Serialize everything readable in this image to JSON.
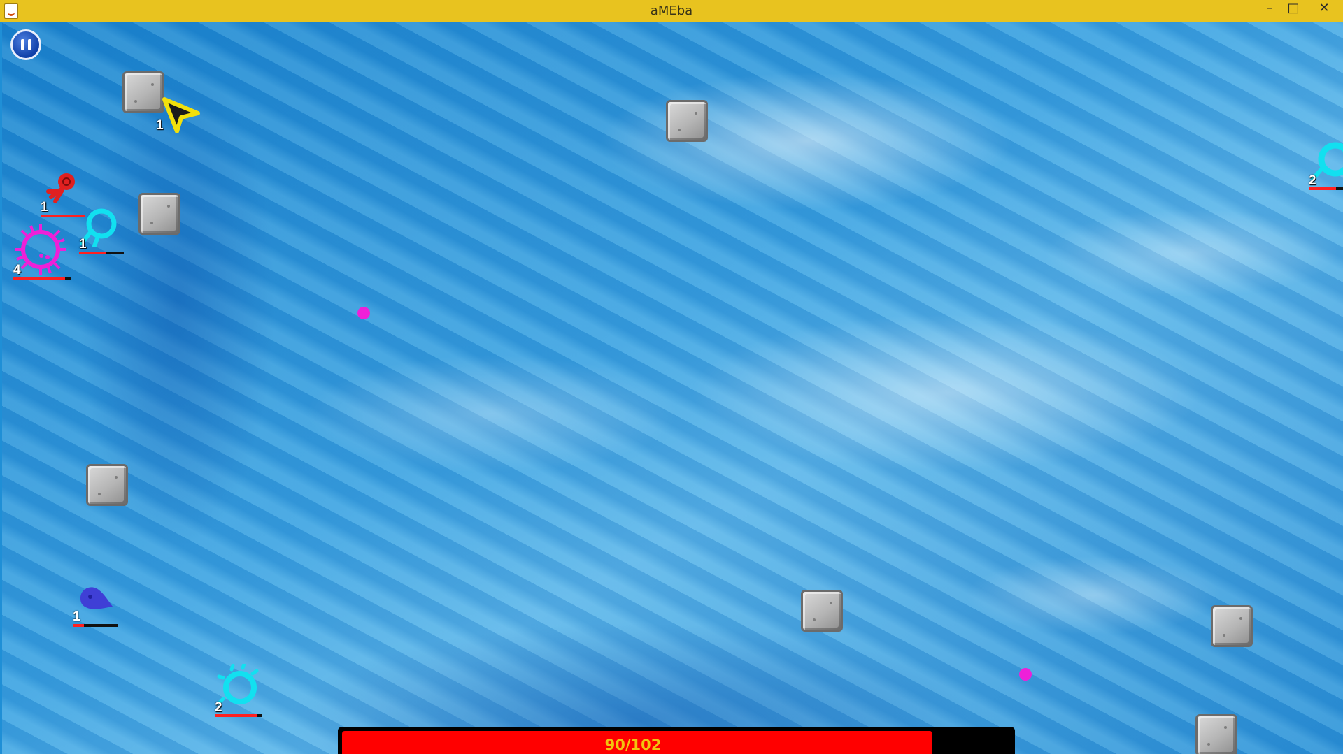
{
  "window": {
    "title": "aMEba",
    "minimize_glyph": "–",
    "maximize_glyph": "□",
    "close_glyph": "✕"
  },
  "hud": {
    "pause_icon": "pause-icon",
    "energy": {
      "label": "90/102",
      "current": 90,
      "max": 102,
      "fill_color": "#ff0000",
      "text_color": "#f1c40f"
    }
  },
  "player": {
    "level": "1",
    "color": "#f2e00c"
  },
  "units": [
    {
      "kind": "red-creature",
      "level": "1",
      "color": "#e02020",
      "health_fraction": 1.0
    },
    {
      "kind": "cyan-creature",
      "level": "1",
      "color": "#12e0f0",
      "health_fraction": 0.6
    },
    {
      "kind": "magenta-spiked-creature",
      "level": "4",
      "color": "#ee20d8",
      "health_fraction": 0.9
    },
    {
      "kind": "blue-blob-creature",
      "level": "1",
      "color": "#3f3fd6",
      "health_fraction": 0.25
    },
    {
      "kind": "cyan-ring-creature",
      "level": "2",
      "color": "#12e0f0",
      "health_fraction": 0.9
    },
    {
      "kind": "cyan-edge-creature",
      "level": "2",
      "color": "#12e0f0",
      "health_fraction": 0.8
    }
  ],
  "rocks": 8,
  "food_pellets": 2,
  "colors": {
    "titlebar": "#e8c31f",
    "water": "#2b93d8"
  }
}
